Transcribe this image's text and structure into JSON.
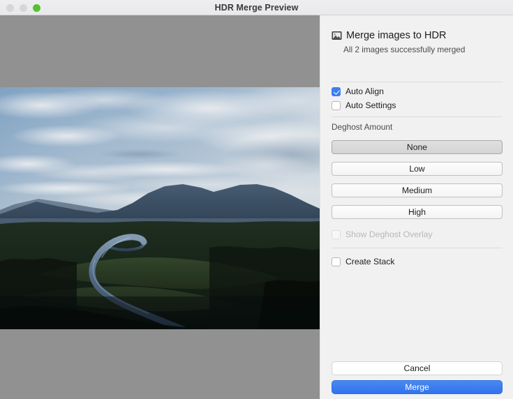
{
  "window": {
    "title": "HDR Merge Preview",
    "traffic_lights": [
      {
        "name": "close",
        "color": "#d6d6d6"
      },
      {
        "name": "minimize",
        "color": "#d6d6d6"
      },
      {
        "name": "maximize",
        "color": "#53c32c"
      }
    ]
  },
  "preview": {
    "backdrop_color": "#919191",
    "image_alt": "Aerial photo of a winding river through dark evergreen forest with distant mountains under a cloudy blue sky"
  },
  "panel": {
    "header": {
      "icon": "photo-icon",
      "title": "Merge images to HDR",
      "subtitle": "All 2 images successfully merged"
    },
    "options": [
      {
        "id": "auto-align",
        "label": "Auto Align",
        "checked": true,
        "disabled": false
      },
      {
        "id": "auto-settings",
        "label": "Auto Settings",
        "checked": false,
        "disabled": false
      }
    ],
    "deghost": {
      "section_label": "Deghost Amount",
      "selected": "None",
      "choices": [
        {
          "label": "None",
          "selected": true
        },
        {
          "label": "Low",
          "selected": false
        },
        {
          "label": "Medium",
          "selected": false
        },
        {
          "label": "High",
          "selected": false
        }
      ]
    },
    "overlay_option": {
      "id": "show-deghost-overlay",
      "label": "Show Deghost Overlay",
      "checked": false,
      "disabled": true
    },
    "stack_option": {
      "id": "create-stack",
      "label": "Create Stack",
      "checked": false,
      "disabled": false
    },
    "footer": {
      "cancel_label": "Cancel",
      "merge_label": "Merge",
      "merge_color": "#3b7ff0"
    }
  }
}
